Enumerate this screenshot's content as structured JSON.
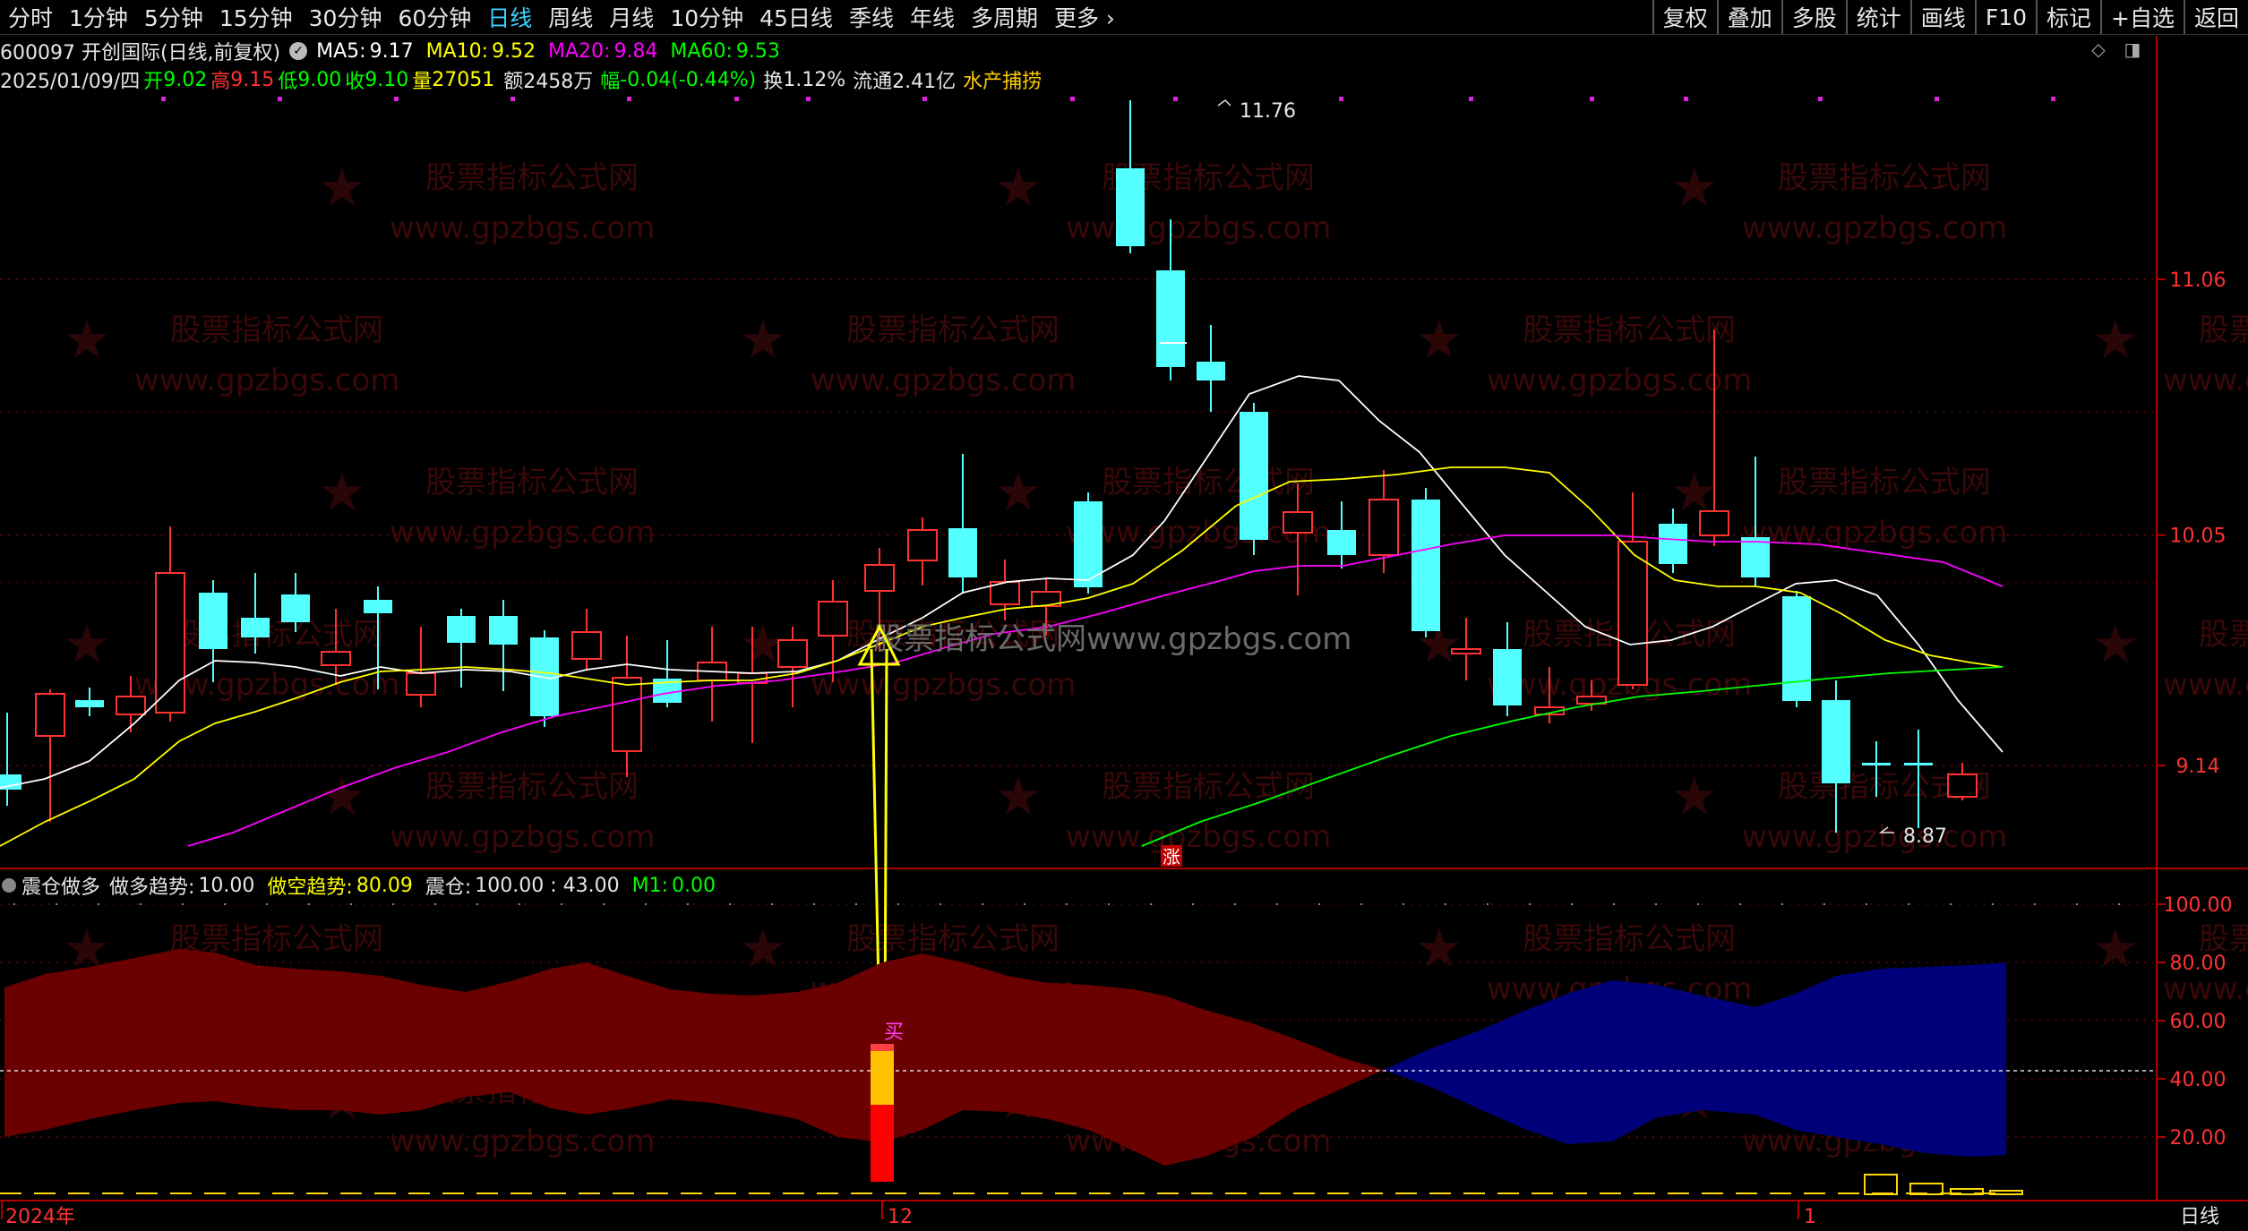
{
  "toolbar": {
    "periods": [
      "分时",
      "1分钟",
      "5分钟",
      "15分钟",
      "30分钟",
      "60分钟",
      "日线",
      "周线",
      "月线",
      "10分钟",
      "45日线",
      "季线",
      "年线",
      "多周期",
      "更多"
    ],
    "selected_index": 6,
    "right_buttons": [
      "复权",
      "叠加",
      "多股",
      "统计",
      "画线",
      "F10",
      "标记",
      "+自选",
      "返回"
    ]
  },
  "stock": {
    "code_name": "600097 开创国际(日线,前复权)",
    "ma5_label": "MA5:",
    "ma5": "9.17",
    "ma10_label": "MA10:",
    "ma10": "9.52",
    "ma20_label": "MA20:",
    "ma20": "9.84",
    "ma60_label": "MA60:",
    "ma60": "9.53",
    "date": "2025/01/09/四",
    "open_label": "开",
    "open": "9.02",
    "high_label": "高",
    "high": "9.15",
    "low_label": "低",
    "low": "9.00",
    "close_label": "收",
    "close": "9.10",
    "vol_label": "量",
    "vol": "27051",
    "amount_label": "额",
    "amount": "2458万",
    "chg_label": "幅",
    "chg": "-0.04(-0.44%)",
    "turnover_label": "换",
    "turnover": "1.12%",
    "float_label": "流通",
    "float": "2.41亿",
    "sector": "水产捕捞"
  },
  "price_axis": [
    "11.06",
    "10.05",
    "9.14"
  ],
  "price_marks": {
    "high": "11.76",
    "low": "8.87"
  },
  "indicator": {
    "name": "震仓做多",
    "bull_label": "做多趋势:",
    "bull": "10.00",
    "bear_label": "做空趋势:",
    "bear": "80.09",
    "shake_label": "震仓:",
    "shake": "100.00 : 43.00",
    "m1_label": "M1:",
    "m1": "0.00",
    "axis": [
      "100.00",
      "80.00",
      "60.00",
      "40.00",
      "20.00"
    ],
    "buy_mark": "买",
    "zhang_mark": "涨"
  },
  "time_axis": [
    "2024年",
    "12",
    "1"
  ],
  "period_label": "日线",
  "watermark": {
    "cn": "股票指标公式网",
    "url": "www.gpzbgs.com",
    "overlay": "股票指标公式网www.gpzbgs.com"
  },
  "colors": {
    "up": "#ff3232",
    "down": "#54ffff",
    "ma5": "#ffffff",
    "ma10": "#ffff00",
    "ma20": "#ff00ff",
    "ma60": "#00ff00",
    "bull_area": "#6b0000",
    "bear_area": "#00007a"
  }
}
